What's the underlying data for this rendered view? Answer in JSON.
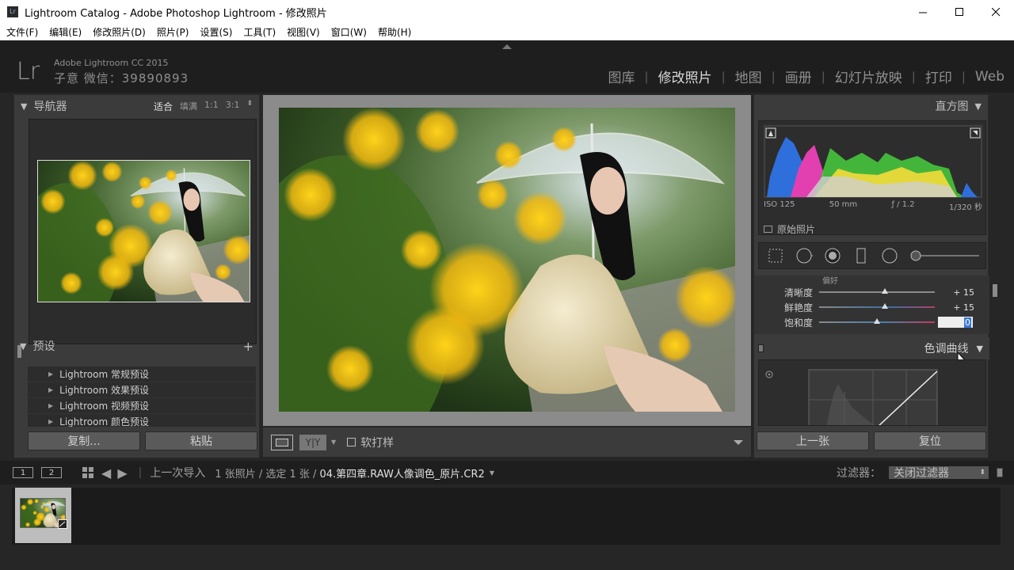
{
  "window": {
    "app_icon": "Lr",
    "title": "Lightroom Catalog - Adobe Photoshop Lightroom - 修改照片",
    "minimize_icon": "minimize-icon",
    "maximize_icon": "maximize-icon",
    "close_icon": "close-icon"
  },
  "menu": [
    "文件(F)",
    "编辑(E)",
    "修改照片(D)",
    "照片(P)",
    "设置(S)",
    "工具(T)",
    "视图(V)",
    "窗口(W)",
    "帮助(H)"
  ],
  "identity": {
    "logo": "Lr",
    "product": "Adobe Lightroom CC 2015",
    "plate": "子意 微信：39890893"
  },
  "modules": {
    "items": [
      "图库",
      "修改照片",
      "地图",
      "画册",
      "幻灯片放映",
      "打印",
      "Web"
    ],
    "active": "修改照片"
  },
  "navigator": {
    "title": "导航器",
    "zoom_options": [
      "适合",
      "填满",
      "1:1",
      "3:1"
    ],
    "active_zoom": "适合",
    "zoom_spinner_icon": "stepper-icon"
  },
  "presets": {
    "title": "预设",
    "add_icon": "plus-icon",
    "items": [
      "Lightroom 常规预设",
      "Lightroom 效果预设",
      "Lightroom 视频预设",
      "Lightroom 颜色预设"
    ]
  },
  "left_buttons": {
    "copy": "复制...",
    "paste": "粘贴"
  },
  "toolbar": {
    "view_mode_icon": "loupe-view-icon",
    "before_after": "Y|Y",
    "softproof_label": "软打样"
  },
  "histogram": {
    "title": "直方图",
    "iso": "ISO 125",
    "focal": "50 mm",
    "aperture": "ƒ / 1.2",
    "shutter": "1/320 秒",
    "original_label": "原始照片"
  },
  "basic": {
    "partial_label": "偏好",
    "sliders": [
      {
        "label": "清晰度",
        "value": "+ 15",
        "level": 0.57
      },
      {
        "label": "鲜艳度",
        "value": "+ 15",
        "level": 0.57
      },
      {
        "label": "饱和度",
        "value": "0",
        "level": 0.5
      }
    ]
  },
  "tone_curve": {
    "title": "色调曲线",
    "target_icon": "target-adjust-icon"
  },
  "right_buttons": {
    "prev": "上一张",
    "reset": "复位"
  },
  "filmstrip_bar": {
    "screen1": "1",
    "screen2": "2",
    "source": "上一次导入",
    "count": "1 张照片 / 选定 1 张 /",
    "filename": "04.第四章.RAW人像调色_原片.CR2",
    "filter_label": "过滤器：",
    "filter_value": "关闭过滤器"
  },
  "colors": {
    "accent_selection": "#3b78d8",
    "histogram_blue": "#2f6fdc",
    "histogram_magenta": "#e23fb0",
    "histogram_yellow": "#e3d83a",
    "histogram_green": "#47c43d"
  }
}
